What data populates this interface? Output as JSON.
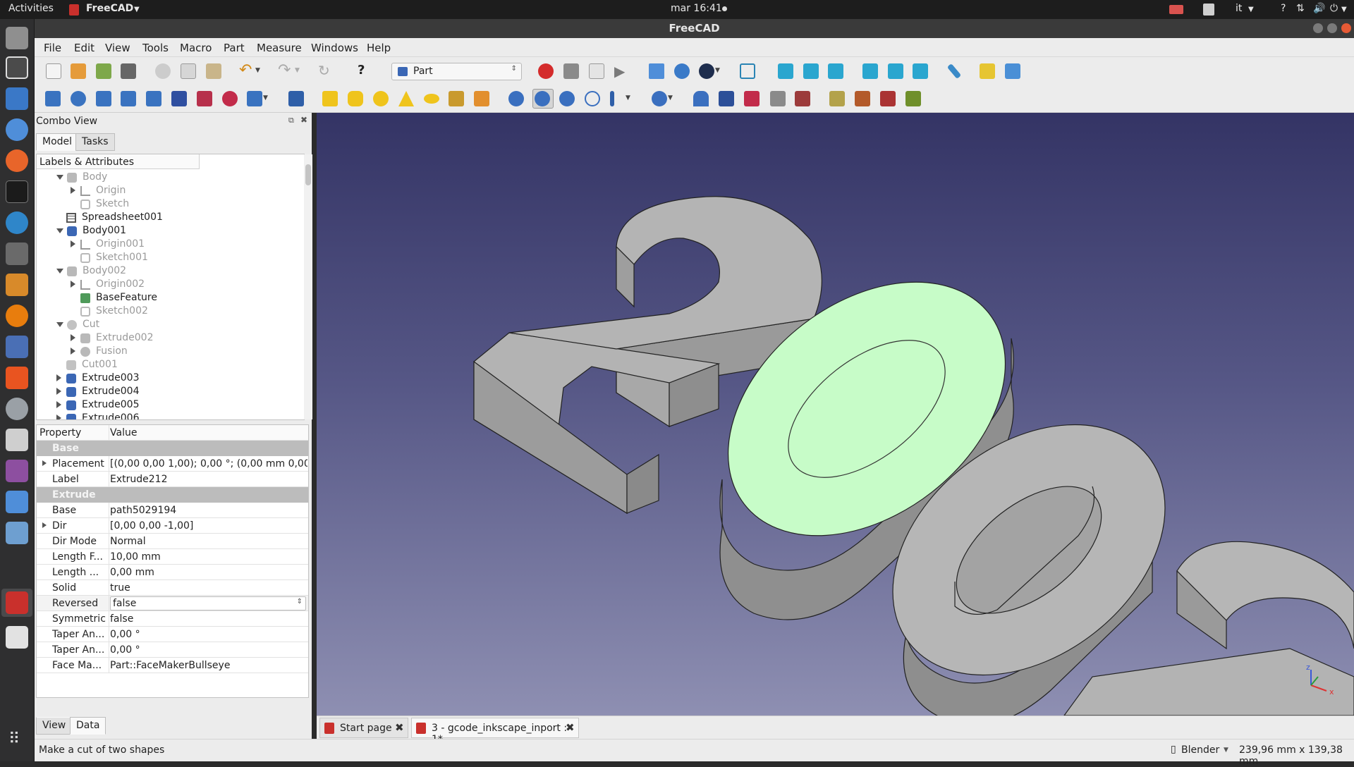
{
  "topbar": {
    "activities": "Activities",
    "app_menu": "FreeCAD",
    "clock": "mar 16:41",
    "lang": "it",
    "help": "?"
  },
  "window": {
    "title": "FreeCAD"
  },
  "menu": [
    "File",
    "Edit",
    "View",
    "Tools",
    "Macro",
    "Part",
    "Measure",
    "Windows",
    "Help"
  ],
  "workbench": "Part",
  "combo": {
    "title": "Combo View",
    "tabs": [
      "Model",
      "Tasks"
    ],
    "bottom_tabs": [
      "View",
      "Data"
    ]
  },
  "tree": {
    "header": "Labels & Attributes",
    "rows": [
      {
        "label": "Body",
        "dim": true
      },
      {
        "label": "Origin",
        "dim": true
      },
      {
        "label": "Sketch",
        "dim": true
      },
      {
        "label": "Spreadsheet001",
        "dim": false
      },
      {
        "label": "Body001",
        "dim": false
      },
      {
        "label": "Origin001",
        "dim": true
      },
      {
        "label": "Sketch001",
        "dim": true
      },
      {
        "label": "Body002",
        "dim": true
      },
      {
        "label": "Origin002",
        "dim": true
      },
      {
        "label": "BaseFeature",
        "dim": false
      },
      {
        "label": "Sketch002",
        "dim": true
      },
      {
        "label": "Cut",
        "dim": true
      },
      {
        "label": "Extrude002",
        "dim": true
      },
      {
        "label": "Fusion",
        "dim": true
      },
      {
        "label": "Cut001",
        "dim": true
      },
      {
        "label": "Extrude003",
        "dim": false
      },
      {
        "label": "Extrude004",
        "dim": false
      },
      {
        "label": "Extrude005",
        "dim": false
      },
      {
        "label": "Extrude006",
        "dim": false
      }
    ]
  },
  "properties": {
    "header": {
      "property": "Property",
      "value": "Value"
    },
    "groups": [
      {
        "name": "Base",
        "rows": [
          {
            "name": "Placement",
            "value": "[(0,00 0,00 1,00); 0,00 °; (0,00 mm  0,00 ..."
          },
          {
            "name": "Label",
            "value": "Extrude212"
          }
        ]
      },
      {
        "name": "Extrude",
        "rows": [
          {
            "name": "Base",
            "value": "path5029194"
          },
          {
            "name": "Dir",
            "value": "[0,00 0,00 -1,00]"
          },
          {
            "name": "Dir Mode",
            "value": "Normal"
          },
          {
            "name": "Length F...",
            "value": "10,00 mm"
          },
          {
            "name": "Length ...",
            "value": "0,00 mm"
          },
          {
            "name": "Solid",
            "value": "true"
          },
          {
            "name": "Reversed",
            "value": "false"
          },
          {
            "name": "Symmetric",
            "value": "false"
          },
          {
            "name": "Taper An...",
            "value": "0,00 °"
          },
          {
            "name": "Taper An...",
            "value": "0,00 °"
          },
          {
            "name": "Face Ma...",
            "value": "Part::FaceMakerBullseye"
          }
        ]
      }
    ]
  },
  "doc_tabs": [
    {
      "label": "Start page"
    },
    {
      "label": "3 - gcode_inkscape_inport : 1*"
    }
  ],
  "status": {
    "message": "Make a cut of two shapes",
    "nav_style": "Blender",
    "dimensions": "239,96 mm x 139,38 mm"
  },
  "axis_labels": {
    "x": "x",
    "z": "z"
  }
}
